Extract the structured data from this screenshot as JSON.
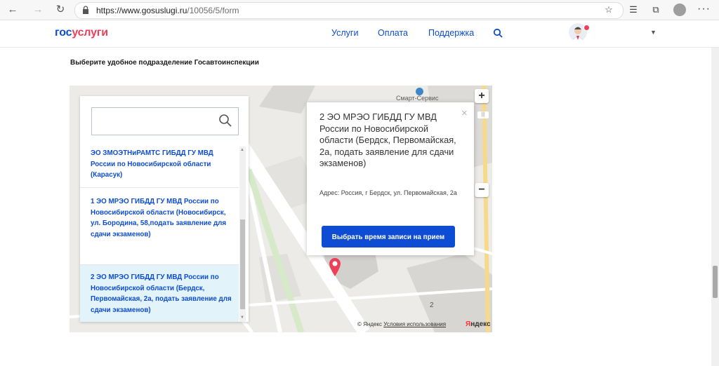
{
  "browser": {
    "url_base": "https://www.gosuslugi.ru",
    "url_path": "/10056/5/form",
    "icons": [
      "back-icon",
      "forward-icon",
      "refresh-icon",
      "lock-icon",
      "favorite-star-icon",
      "favorites-list-icon",
      "collections-icon",
      "profile-icon",
      "more-icon"
    ]
  },
  "header": {
    "logo_part1": "гос",
    "logo_part2": "услуги",
    "nav": [
      "Услуги",
      "Оплата",
      "Поддержка"
    ],
    "brand_colors": {
      "blue": "#0d4cd3",
      "red": "#ee3f58"
    }
  },
  "form": {
    "section_title": "Выберите удобное подразделение Госавтоинспекции"
  },
  "offices": {
    "search_placeholder": "",
    "items": [
      "ЭО ЗМОЭТНиРАМТС ГИБДД ГУ МВД России по Новосибирской области (Карасук)",
      "1 ЭО МРЭО ГИБДД ГУ МВД России по Новосибирской области (Новосибирск, ул. Бородина, 58,подать заявление для сдачи экзаменов)",
      "2 ЭО МРЭО ГИБДД ГУ МВД России по Новосибирской области (Бердск, Первомайская, 2а, подать заявление для сдачи экзаменов)"
    ],
    "selected_index": 2
  },
  "balloon": {
    "title": "2 ЭО МРЭО ГИБДД ГУ МВД России по Новосибирской области (Бердск, Первомайская, 2а, подать заявление для сдачи экзаменов)",
    "address": "Адрес: Россия, г Бердск, ул. Первомайская, 2а",
    "button_label": "Выбрать время записи на прием",
    "close_symbol": "×"
  },
  "map": {
    "place_label": "Смарт-Сервис",
    "house_number": "2",
    "zoom_in": "+",
    "zoom_out": "−",
    "copyright_prefix": "© Яндекс",
    "terms_link": "Условия использования",
    "yandex_logo_first": "Я",
    "yandex_logo_rest": "ндекс"
  }
}
